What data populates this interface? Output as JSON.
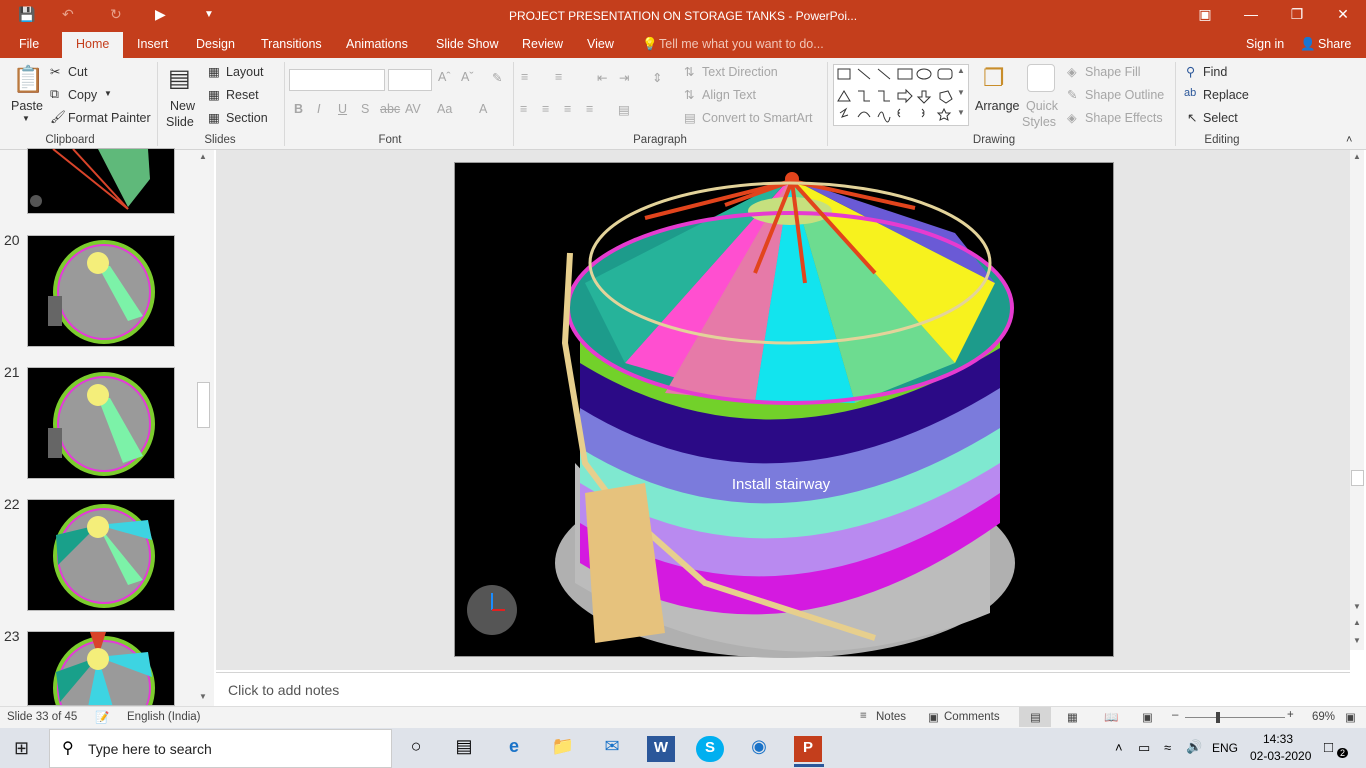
{
  "window": {
    "title": "PROJECT PRESENTATION ON STORAGE TANKS - PowerPoi..."
  },
  "tabs": [
    "File",
    "Home",
    "Insert",
    "Design",
    "Transitions",
    "Animations",
    "Slide Show",
    "Review",
    "View"
  ],
  "tell_me": "Tell me what you want to do...",
  "signin": "Sign in",
  "share": "Share",
  "ribbon": {
    "paste": "Paste",
    "cut": "Cut",
    "copy": "Copy",
    "format_painter": "Format Painter",
    "clipboard": "Clipboard",
    "new_slide_1": "New",
    "new_slide_2": "Slide",
    "layout": "Layout",
    "reset": "Reset",
    "section": "Section",
    "slides": "Slides",
    "font": "Font",
    "text_direction": "Text Direction",
    "align_text": "Align Text",
    "convert_smartart": "Convert to SmartArt",
    "paragraph": "Paragraph",
    "arrange": "Arrange",
    "quick_styles_1": "Quick",
    "quick_styles_2": "Styles",
    "shape_fill": "Shape Fill",
    "shape_outline": "Shape Outline",
    "shape_effects": "Shape Effects",
    "drawing": "Drawing",
    "find": "Find",
    "replace": "Replace",
    "select": "Select",
    "editing": "Editing"
  },
  "thumbnails": [
    {
      "num": "20"
    },
    {
      "num": "21"
    },
    {
      "num": "22"
    },
    {
      "num": "23"
    }
  ],
  "slide": {
    "caption": "Install stairway"
  },
  "notes_placeholder": "Click to add notes",
  "status": {
    "slide_of": "Slide 33 of 45",
    "language": "English (India)",
    "notes": "Notes",
    "comments": "Comments",
    "zoom": "69%"
  },
  "taskbar": {
    "search": "Type here to search",
    "lang": "ENG",
    "time": "14:33",
    "date": "02-03-2020",
    "notif_count": "2"
  },
  "colors": {
    "accent": "#c43e1c"
  }
}
